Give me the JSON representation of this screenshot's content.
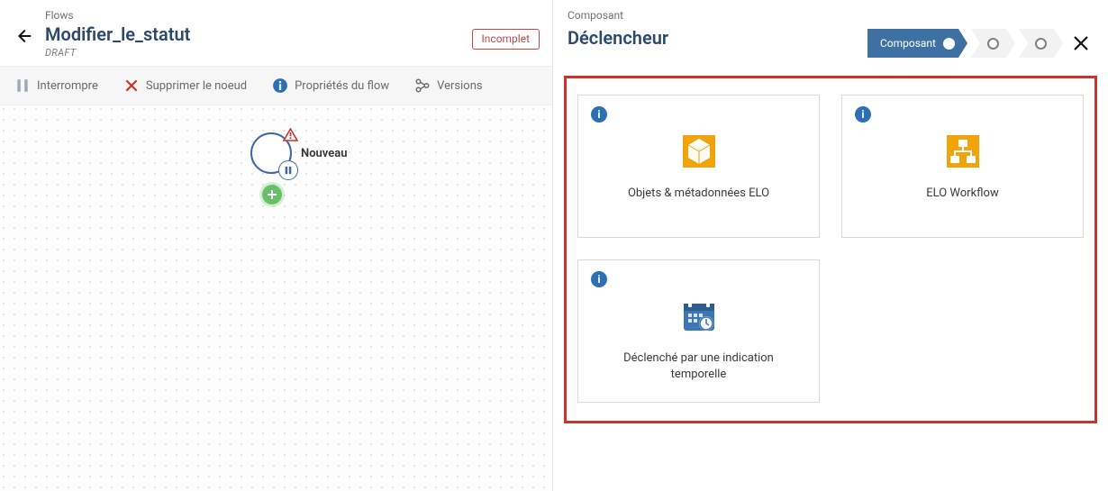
{
  "left": {
    "eyebrow": "Flows",
    "title": "Modifier_le_statut",
    "draft": "DRAFT",
    "incomplete": "Incomplet",
    "actions": {
      "interrupt": "Interrompre",
      "delete_node": "Supprimer le noeud",
      "flow_props": "Propriétés du flow",
      "versions": "Versions"
    },
    "node_label": "Nouveau"
  },
  "right": {
    "eyebrow": "Composant",
    "title": "Déclencheur",
    "step_active": "Composant",
    "cards": {
      "elo_objects": "Objets & métadonnées ELO",
      "elo_workflow": "ELO Workflow",
      "elo_time": "Déclenché par une indication temporelle"
    }
  },
  "icons": {
    "info_letter": "i"
  }
}
